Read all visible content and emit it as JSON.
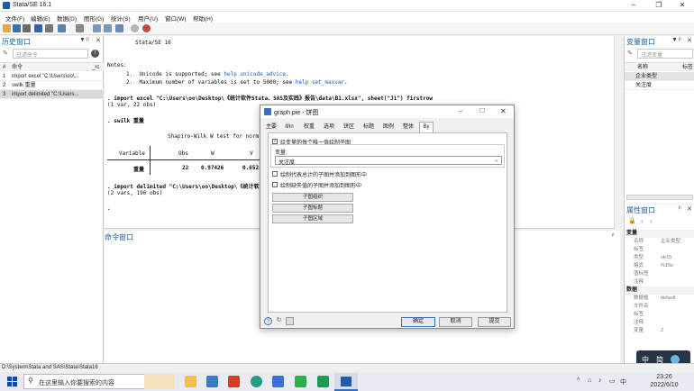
{
  "window": {
    "title": "Stata/SE 16.1",
    "min": "–",
    "max": "❐",
    "close": "✕"
  },
  "menu": [
    "文件(F)",
    "编辑(E)",
    "数据(D)",
    "图形(G)",
    "统计(S)",
    "用户(U)",
    "窗口(W)",
    "帮助(H)"
  ],
  "history": {
    "title": "历史窗口",
    "filter_placeholder": "过滤命令",
    "col_num": "#",
    "col_cmd": "命令",
    "col_rc": "_rc",
    "rows": [
      {
        "n": "1",
        "cmd": "import excel \"C:\\Users\\oo\\..."
      },
      {
        "n": "2",
        "cmd": "swilk 重量"
      },
      {
        "n": "3",
        "cmd": "import delimited \"C:\\Users..."
      }
    ]
  },
  "results": {
    "banner": "Stata/SE 16",
    "notes_label": "Notes:",
    "note1_prefix": "1.  Unicode is supported; see ",
    "note1_link": "help unicode_advice",
    "note1_suffix": ".",
    "note2_prefix": "2.  Maximum number of variables is set to 5000; see ",
    "note2_link": "help set_maxvar",
    "note2_suffix": ".",
    "cmd1": ". import excel \"C:\\Users\\oo\\Desktop\\《统计软件Stata、SAS及实践》报告\\data\\B1.xlsx\", sheet(\"J1\") firstrow",
    "out1": "(1 var, 22 obs)",
    "cmd2": ". swilk 重量",
    "test_title": "Shapiro-Wilk W test for norm",
    "th_variable": "Variable",
    "th_obs": "Obs",
    "th_w": "W",
    "th_v": "V",
    "tr_variable": "重量",
    "tr_obs": "22",
    "tr_w": "0.97426",
    "tr_v": "0.652",
    "cmd3": ". import delimited \"C:\\Users\\oo\\Desktop\\《统计软",
    "out3": "(2 vars, 190 obs)",
    "prompt": "."
  },
  "cmd_window": {
    "title": "命令窗口"
  },
  "variables": {
    "title": "变量窗口",
    "filter_placeholder": "过滤变量",
    "col_name": "名称",
    "col_label": "标签",
    "items": [
      "企业类型",
      "关注度"
    ]
  },
  "properties": {
    "title": "属性窗口",
    "section_var": "变量",
    "var_rows": [
      {
        "k": "名称",
        "v": "企业类型"
      },
      {
        "k": "标签",
        "v": ""
      },
      {
        "k": "类型",
        "v": "str15"
      },
      {
        "k": "格式",
        "v": "%15s"
      },
      {
        "k": "值标签",
        "v": ""
      },
      {
        "k": "注释",
        "v": ""
      }
    ],
    "section_data": "数据",
    "data_rows": [
      {
        "k": "数据框",
        "v": "default"
      },
      {
        "k": "文件名",
        "v": ""
      },
      {
        "k": "标签",
        "v": ""
      },
      {
        "k": "注释",
        "v": ""
      },
      {
        "k": "变量",
        "v": "2"
      }
    ]
  },
  "dialog": {
    "title": "graph pie - 饼图",
    "tabs": [
      "主要",
      "if/in",
      "权重",
      "选项",
      "饼区",
      "标题",
      "图例",
      "整体",
      "By"
    ],
    "opt_by": "绘变量的每个唯一值绘制子图",
    "var_label": "变量:",
    "var_value": "关注度",
    "opt_total": "绘制代表总计的子图并添加到图形中",
    "opt_missing": "绘制缺失值的子图并添加到图形中",
    "btn_subgroup": "子图组织",
    "btn_subtitle": "子图标题",
    "btn_subregion": "子图区域",
    "ok": "确定",
    "cancel": "取消",
    "submit": "提交"
  },
  "status_path": "D:\\System\\Stata and SAS\\Stata\\Stata16",
  "taskbar": {
    "search_placeholder": "在这里输入你要搜索的内容",
    "time": "23:26",
    "date": "2022/6/10",
    "ime_zh": "中",
    "ime_simplified": "简"
  }
}
